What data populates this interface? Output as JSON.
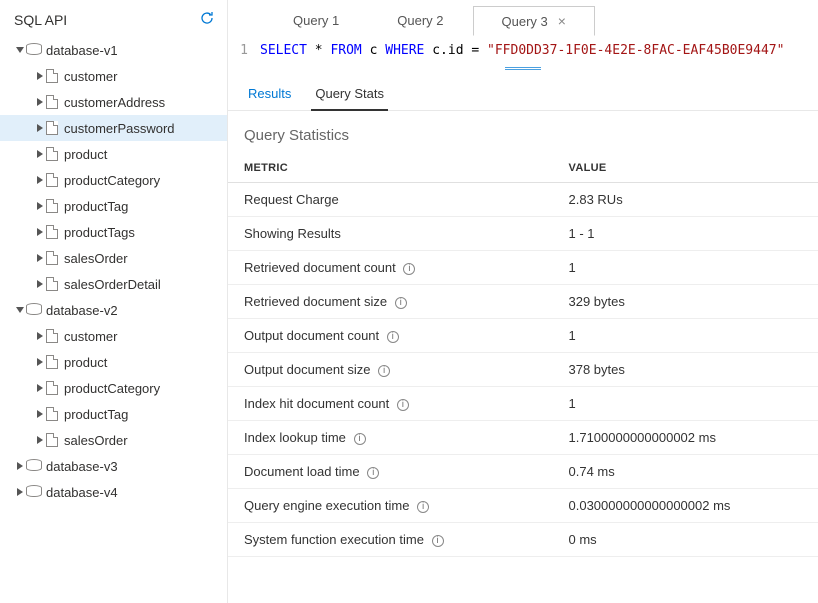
{
  "sidebar": {
    "title": "SQL API",
    "databases": [
      {
        "name": "database-v1",
        "expanded": true,
        "containers": [
          {
            "name": "customer"
          },
          {
            "name": "customerAddress"
          },
          {
            "name": "customerPassword",
            "selected": true
          },
          {
            "name": "product"
          },
          {
            "name": "productCategory"
          },
          {
            "name": "productTag"
          },
          {
            "name": "productTags"
          },
          {
            "name": "salesOrder"
          },
          {
            "name": "salesOrderDetail"
          }
        ]
      },
      {
        "name": "database-v2",
        "expanded": true,
        "containers": [
          {
            "name": "customer"
          },
          {
            "name": "product"
          },
          {
            "name": "productCategory"
          },
          {
            "name": "productTag"
          },
          {
            "name": "salesOrder"
          }
        ]
      },
      {
        "name": "database-v3",
        "expanded": false,
        "containers": []
      },
      {
        "name": "database-v4",
        "expanded": false,
        "containers": []
      }
    ]
  },
  "tabs": [
    {
      "label": "Query 1",
      "active": false
    },
    {
      "label": "Query 2",
      "active": false
    },
    {
      "label": "Query 3",
      "active": true,
      "closable": true
    }
  ],
  "query": {
    "lineNumber": "1",
    "tokens": [
      {
        "t": "SELECT",
        "c": "kw"
      },
      {
        "t": " * ",
        "c": "txt"
      },
      {
        "t": "FROM",
        "c": "kw"
      },
      {
        "t": " c ",
        "c": "txt"
      },
      {
        "t": "WHERE",
        "c": "kw"
      },
      {
        "t": " c.id = ",
        "c": "txt"
      },
      {
        "t": "\"FFD0DD37-1F0E-4E2E-8FAC-EAF45B0E9447\"",
        "c": "str"
      }
    ]
  },
  "innerTabs": {
    "results": "Results",
    "queryStats": "Query Stats",
    "active": "queryStats"
  },
  "statsTitle": "Query Statistics",
  "statsHeaders": {
    "metric": "METRIC",
    "value": "VALUE"
  },
  "stats": [
    {
      "metric": "Request Charge",
      "value": "2.83 RUs",
      "info": false
    },
    {
      "metric": "Showing Results",
      "value": "1 - 1",
      "info": false
    },
    {
      "metric": "Retrieved document count",
      "value": "1",
      "info": true
    },
    {
      "metric": "Retrieved document size",
      "value": "329 bytes",
      "info": true
    },
    {
      "metric": "Output document count",
      "value": "1",
      "info": true
    },
    {
      "metric": "Output document size",
      "value": "378 bytes",
      "info": true
    },
    {
      "metric": "Index hit document count",
      "value": "1",
      "info": true
    },
    {
      "metric": "Index lookup time",
      "value": "1.7100000000000002 ms",
      "info": true
    },
    {
      "metric": "Document load time",
      "value": "0.74 ms",
      "info": true
    },
    {
      "metric": "Query engine execution time",
      "value": "0.030000000000000002 ms",
      "info": true
    },
    {
      "metric": "System function execution time",
      "value": "0 ms",
      "info": true
    }
  ]
}
